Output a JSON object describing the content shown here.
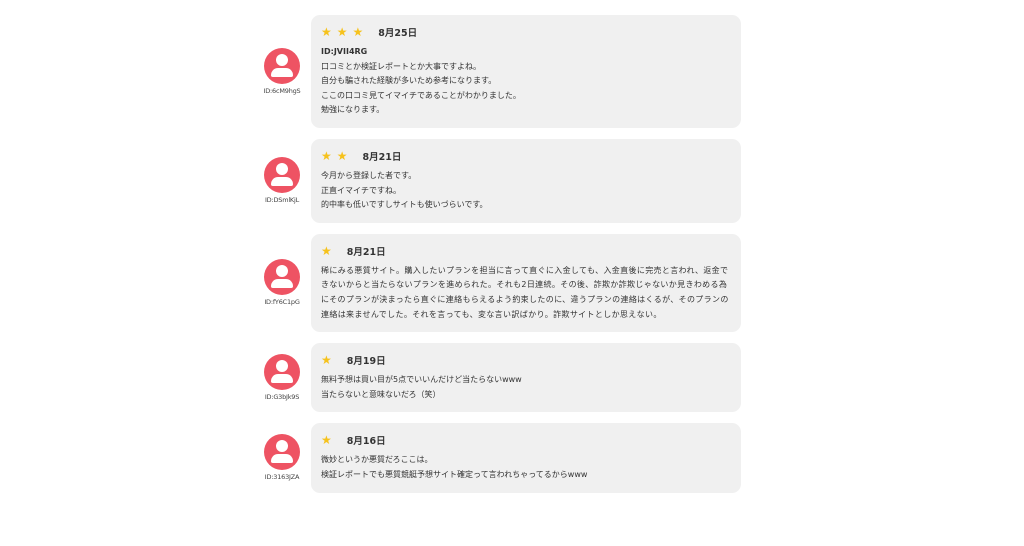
{
  "colors": {
    "avatar": "#ee5363",
    "star": "#f6c21c",
    "bubble_background": "#f0f0f0"
  },
  "reviews": [
    {
      "user_id": "ID:6cM9hgS",
      "stars": 3,
      "date": "8月25日",
      "lines": [
        "ID:JVII4RG",
        "口コミとか検証レポートとか大事ですよね。",
        "自分も騙された経験が多いため参考になります。",
        "ここの口コミ見てイマイチであることがわかりました。",
        "勉強になります。"
      ]
    },
    {
      "user_id": "ID:DSmlKjL",
      "stars": 2,
      "date": "8月21日",
      "lines": [
        "今月から登録した者です。",
        "正直イマイチですね。",
        "的中率も低いですしサイトも使いづらいです。"
      ]
    },
    {
      "user_id": "ID:fY6C1pG",
      "stars": 1,
      "date": "8月21日",
      "text": "稀にみる悪質サイト。購入したいプランを担当に言って直ぐに入金しても、入金直後に完売と言われ、返金できないからと当たらないプランを進められた。それも2日連続。その後、詐欺か詐欺じゃないか見きわめる為にそのプランが決まったら直ぐに連絡もらえるよう約束したのに、違うプランの連絡はくるが、そのプランの連絡は来ませんでした。それを言っても、変な言い訳ばかり。詐欺サイトとしか思えない。"
    },
    {
      "user_id": "ID:G3bJk9S",
      "stars": 1,
      "date": "8月19日",
      "lines": [
        "無料予想は買い目が5点でいいんだけど当たらないwww",
        "当たらないと意味ないだろ（笑）"
      ]
    },
    {
      "user_id": "ID:3163JZA",
      "stars": 1,
      "date": "8月16日",
      "lines": [
        "微妙というか悪質だろここは。",
        "検証レポートでも悪質競艇予想サイト確定って言われちゃってるからwww"
      ]
    }
  ]
}
